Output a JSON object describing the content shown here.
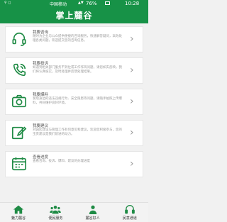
{
  "status_bar": {
    "left_text": "⚲  ◻",
    "carrier": "中国移动",
    "signal_text": "▲▼",
    "battery_pct": "76%",
    "time": "10:28"
  },
  "header": {
    "title": "掌上麓谷"
  },
  "cards": [
    {
      "title": "我要咨询",
      "desc": "随时为企业与公众提供便捷的咨询服务，快速解答疑问，高效处理各类问题，欢迎提交您的咨询信息。",
      "icon": "headset-icon"
    },
    {
      "title": "我要投诉",
      "desc": "如遇到相关部门服务不到位或工作作风问题，请您如实反映，我们将认真核实，及时处理并反馈处理结果。",
      "icon": "phone-icon"
    },
    {
      "title": "我要爆料",
      "desc": "发现身边的违法违规行为、安全隐患等问题，请随手拍照上传爆料，共同维护良好环境。",
      "icon": "camera-icon"
    },
    {
      "title": "我要建议",
      "desc": "对园区建设与管理工作有何意见和建议，欢迎您积极参与，您的宝贵建议是我们前进的动力。",
      "icon": "pencil-icon"
    },
    {
      "title": "查看进度",
      "desc": "查看咨询、投诉、爆料、建议的办理进度",
      "icon": "calendar-icon"
    }
  ],
  "bottom_nav": [
    {
      "label": "魅力麓谷",
      "icon": "home-icon"
    },
    {
      "label": "便民服务",
      "icon": "people-icon"
    },
    {
      "label": "麓谷好人",
      "icon": "person-icon"
    },
    {
      "label": "民意通道",
      "icon": "headset-icon"
    }
  ]
}
